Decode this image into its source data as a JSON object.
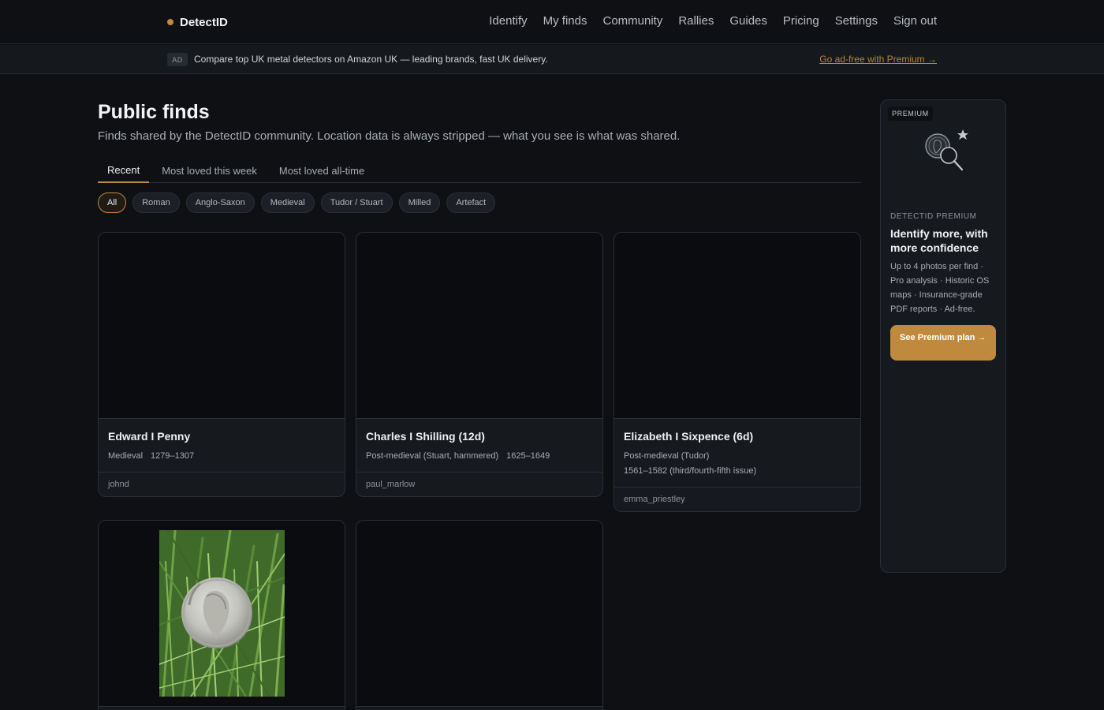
{
  "nav": {
    "brand": "DetectID",
    "links": [
      "Identify",
      "My finds",
      "Community",
      "Rallies",
      "Guides",
      "Pricing",
      "Settings",
      "Sign out"
    ]
  },
  "ad": {
    "badge": "AD",
    "text": "Compare top UK metal detectors on Amazon UK — leading brands, fast UK delivery.",
    "premium_link": "Go ad-free with Premium →"
  },
  "main": {
    "title": "Public finds",
    "subtitle": "Finds shared by the DetectID community. Location data is always stripped — what you see is what was shared.",
    "tabs": [
      "Recent",
      "Most loved this week",
      "Most loved all-time"
    ],
    "active_tab": "Recent",
    "chips": [
      "All",
      "Roman",
      "Anglo-Saxon",
      "Medieval",
      "Tudor / Stuart",
      "Milled",
      "Artefact"
    ],
    "active_chip": "All"
  },
  "cards": [
    {
      "title": "Edward I Penny",
      "period": "Medieval",
      "dates": "1279–1307",
      "user": "johnd"
    },
    {
      "title": "Charles I Shilling (12d)",
      "period": "Post-medieval (Stuart, hammered)",
      "dates": "1625–1649",
      "user": "paul_marlow"
    },
    {
      "title": "Elizabeth I Sixpence (6d)",
      "period": "Post-medieval (Tudor)",
      "dates": "1561–1582 (third/fourth-fifth issue)",
      "user": "emma_priestley"
    }
  ],
  "sidebar": {
    "badge": "PREMIUM",
    "kicker": "DETECTID PREMIUM",
    "title": "Identify more, with more confidence",
    "desc": "Up to 4 photos per find · Pro analysis · Historic OS maps · Insurance-grade PDF reports · Ad-free.",
    "cta": "See Premium plan →"
  },
  "colors": {
    "accent": "#c08a3e",
    "background": "#0e1014",
    "card": "#16191e"
  }
}
